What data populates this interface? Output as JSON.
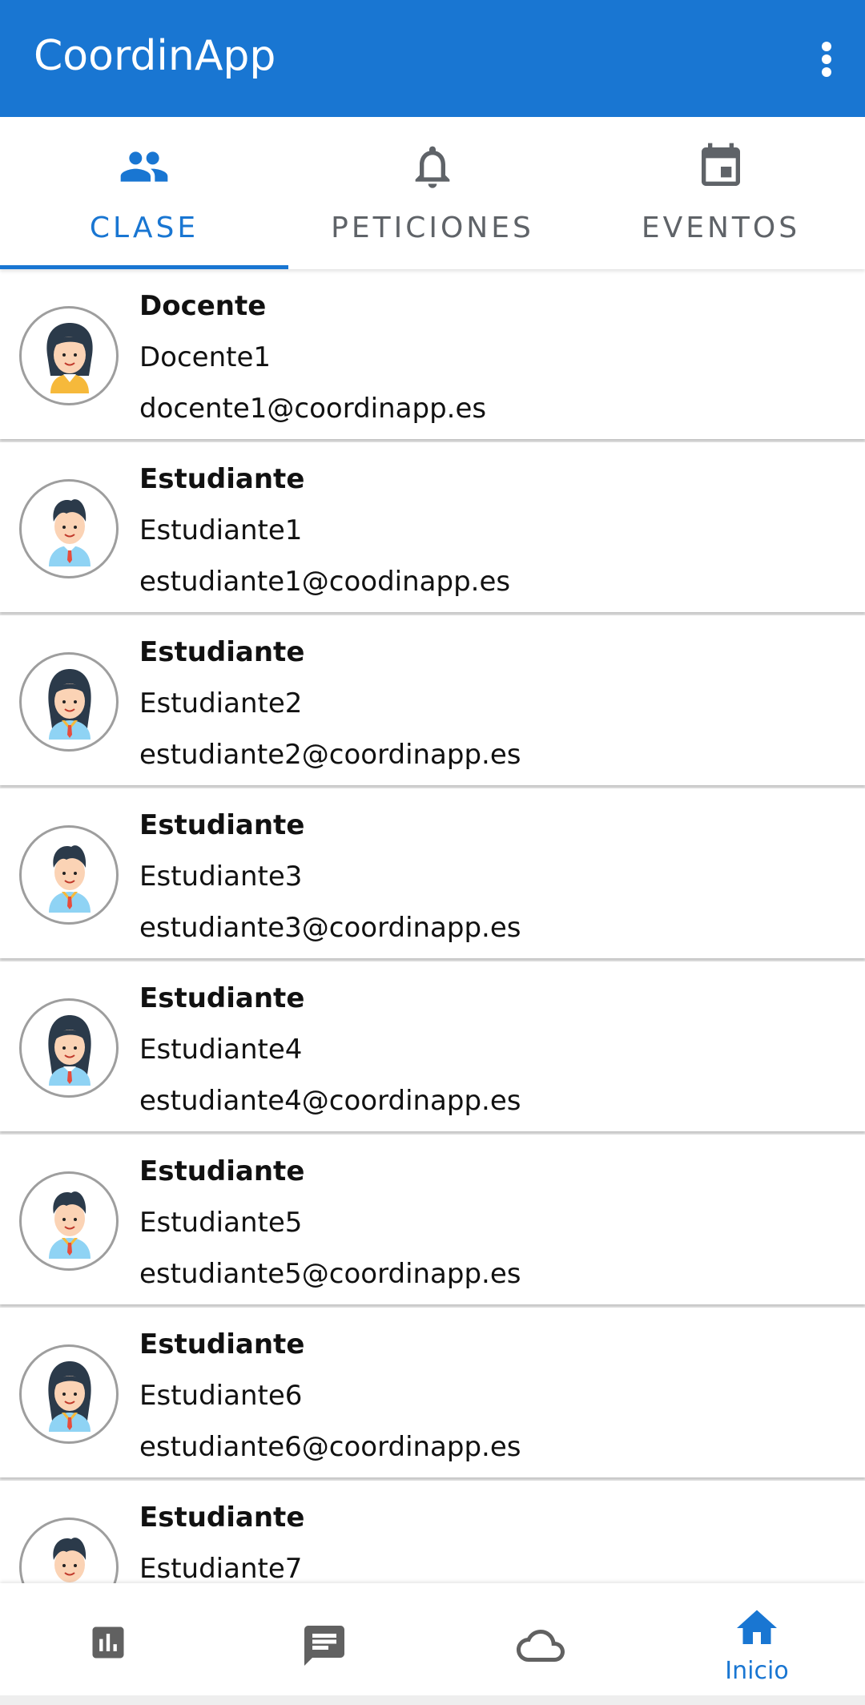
{
  "app": {
    "title": "CoordinApp",
    "colors": {
      "primary": "#1976d2",
      "tab_inactive": "#5f6368",
      "icon_inactive": "#616161"
    },
    "menu_icon": "more-vert-icon"
  },
  "tabs": [
    {
      "label": "CLASE",
      "icon": "people-icon",
      "active": true
    },
    {
      "label": "PETICIONES",
      "icon": "bell-icon",
      "active": false
    },
    {
      "label": "EVENTOS",
      "icon": "calendar-icon",
      "active": false
    }
  ],
  "members": [
    {
      "role": "Docente",
      "name": "Docente1",
      "email": "docente1@coordinapp.es",
      "avatar": "teacher-avatar"
    },
    {
      "role": "Estudiante",
      "name": "Estudiante1",
      "email": "estudiante1@coodinapp.es",
      "avatar": "student-boy-avatar"
    },
    {
      "role": "Estudiante",
      "name": "Estudiante2",
      "email": "estudiante2@coordinapp.es",
      "avatar": "student-girl-avatar"
    },
    {
      "role": "Estudiante",
      "name": "Estudiante3",
      "email": "estudiante3@coordinapp.es",
      "avatar": "student-boy-avatar"
    },
    {
      "role": "Estudiante",
      "name": "Estudiante4",
      "email": "estudiante4@coordinapp.es",
      "avatar": "student-girl-avatar"
    },
    {
      "role": "Estudiante",
      "name": "Estudiante5",
      "email": "estudiante5@coordinapp.es",
      "avatar": "student-boy-avatar"
    },
    {
      "role": "Estudiante",
      "name": "Estudiante6",
      "email": "estudiante6@coordinapp.es",
      "avatar": "student-girl-avatar"
    },
    {
      "role": "Estudiante",
      "name": "Estudiante7",
      "email": "",
      "avatar": "student-boy-avatar"
    }
  ],
  "bottom_nav": [
    {
      "icon": "bar-chart-icon",
      "label": "",
      "active": false
    },
    {
      "icon": "chat-icon",
      "label": "",
      "active": false
    },
    {
      "icon": "cloud-icon",
      "label": "",
      "active": false
    },
    {
      "icon": "home-icon",
      "label": "Inicio",
      "active": true
    }
  ]
}
